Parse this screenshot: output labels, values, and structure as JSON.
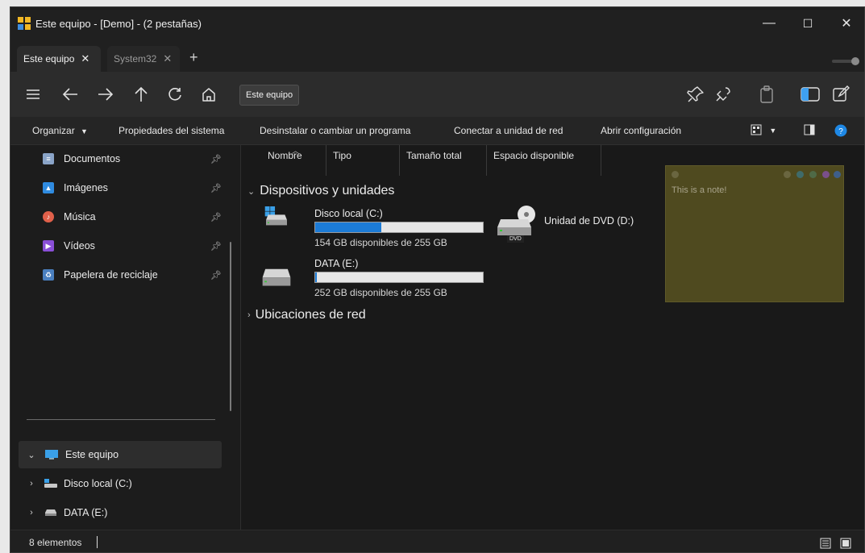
{
  "window": {
    "title": "Este equipo - [Demo] - (2 pestañas)",
    "controls": {
      "minimize": "—",
      "maximize": "☐",
      "close": "✕"
    }
  },
  "tabs": [
    {
      "label": "Este equipo",
      "close": "✕",
      "active": true
    },
    {
      "label": "System32",
      "close": "✕",
      "active": false
    }
  ],
  "tabbar": {
    "new_tab": "+"
  },
  "nav": {
    "address": "Este equipo",
    "icons": [
      "menu-icon",
      "back-arrow-icon",
      "forward-arrow-icon",
      "up-arrow-icon",
      "refresh-icon",
      "home-icon",
      "pin-icon",
      "unpin-icon",
      "clipboard-icon",
      "dual-pane-icon",
      "edit-icon"
    ]
  },
  "commands": {
    "organize": "Organizar",
    "system_properties": "Propiedades del sistema",
    "uninstall": "Desinstalar o cambiar un programa",
    "map_drive": "Conectar a unidad de red",
    "open_settings": "Abrir configuración"
  },
  "sidebar": {
    "quick_access": [
      {
        "label": "Documentos",
        "icon": "documents-icon",
        "color": "#8aa4c8"
      },
      {
        "label": "Imágenes",
        "icon": "pictures-icon",
        "color": "#2f8be0"
      },
      {
        "label": "Música",
        "icon": "music-icon",
        "color": "#e0604a"
      },
      {
        "label": "Vídeos",
        "icon": "videos-icon",
        "color": "#8a4fd8"
      },
      {
        "label": "Papelera de reciclaje",
        "icon": "recycle-bin-icon",
        "color": "#4a7fbf"
      }
    ],
    "tree": [
      {
        "label": "Este equipo",
        "chevron": "⌄",
        "icon": "computer-icon"
      },
      {
        "label": "Disco local (C:)",
        "chevron": "›",
        "icon": "drive-icon"
      },
      {
        "label": "DATA (E:)",
        "chevron": "›",
        "icon": "drive-icon"
      }
    ]
  },
  "columns": [
    "Nombre",
    "Tipo",
    "Tamaño total",
    "Espacio disponible"
  ],
  "groups": {
    "devices": "Dispositivos y unidades",
    "network": "Ubicaciones de red"
  },
  "drives": [
    {
      "name": "Disco local (C:)",
      "info": "154 GB disponibles de 255 GB",
      "used_fraction": 0.396
    },
    {
      "name": "DATA (E:)",
      "info": "252 GB disponibles de 255 GB",
      "used_fraction": 0.012
    },
    {
      "name": "Unidad de DVD (D:)",
      "badge": "DVD"
    }
  ],
  "note": {
    "text": "This is a note!",
    "background": "#4f4a1f",
    "dots": [
      "#6a6640",
      "#3f6b6a",
      "#4f6a46",
      "#7a4f8a",
      "#3e5f8a"
    ]
  },
  "status": {
    "items": "8 elementos"
  },
  "colors": {
    "accent": "#1c7bd6",
    "help": "#1e88e5"
  }
}
